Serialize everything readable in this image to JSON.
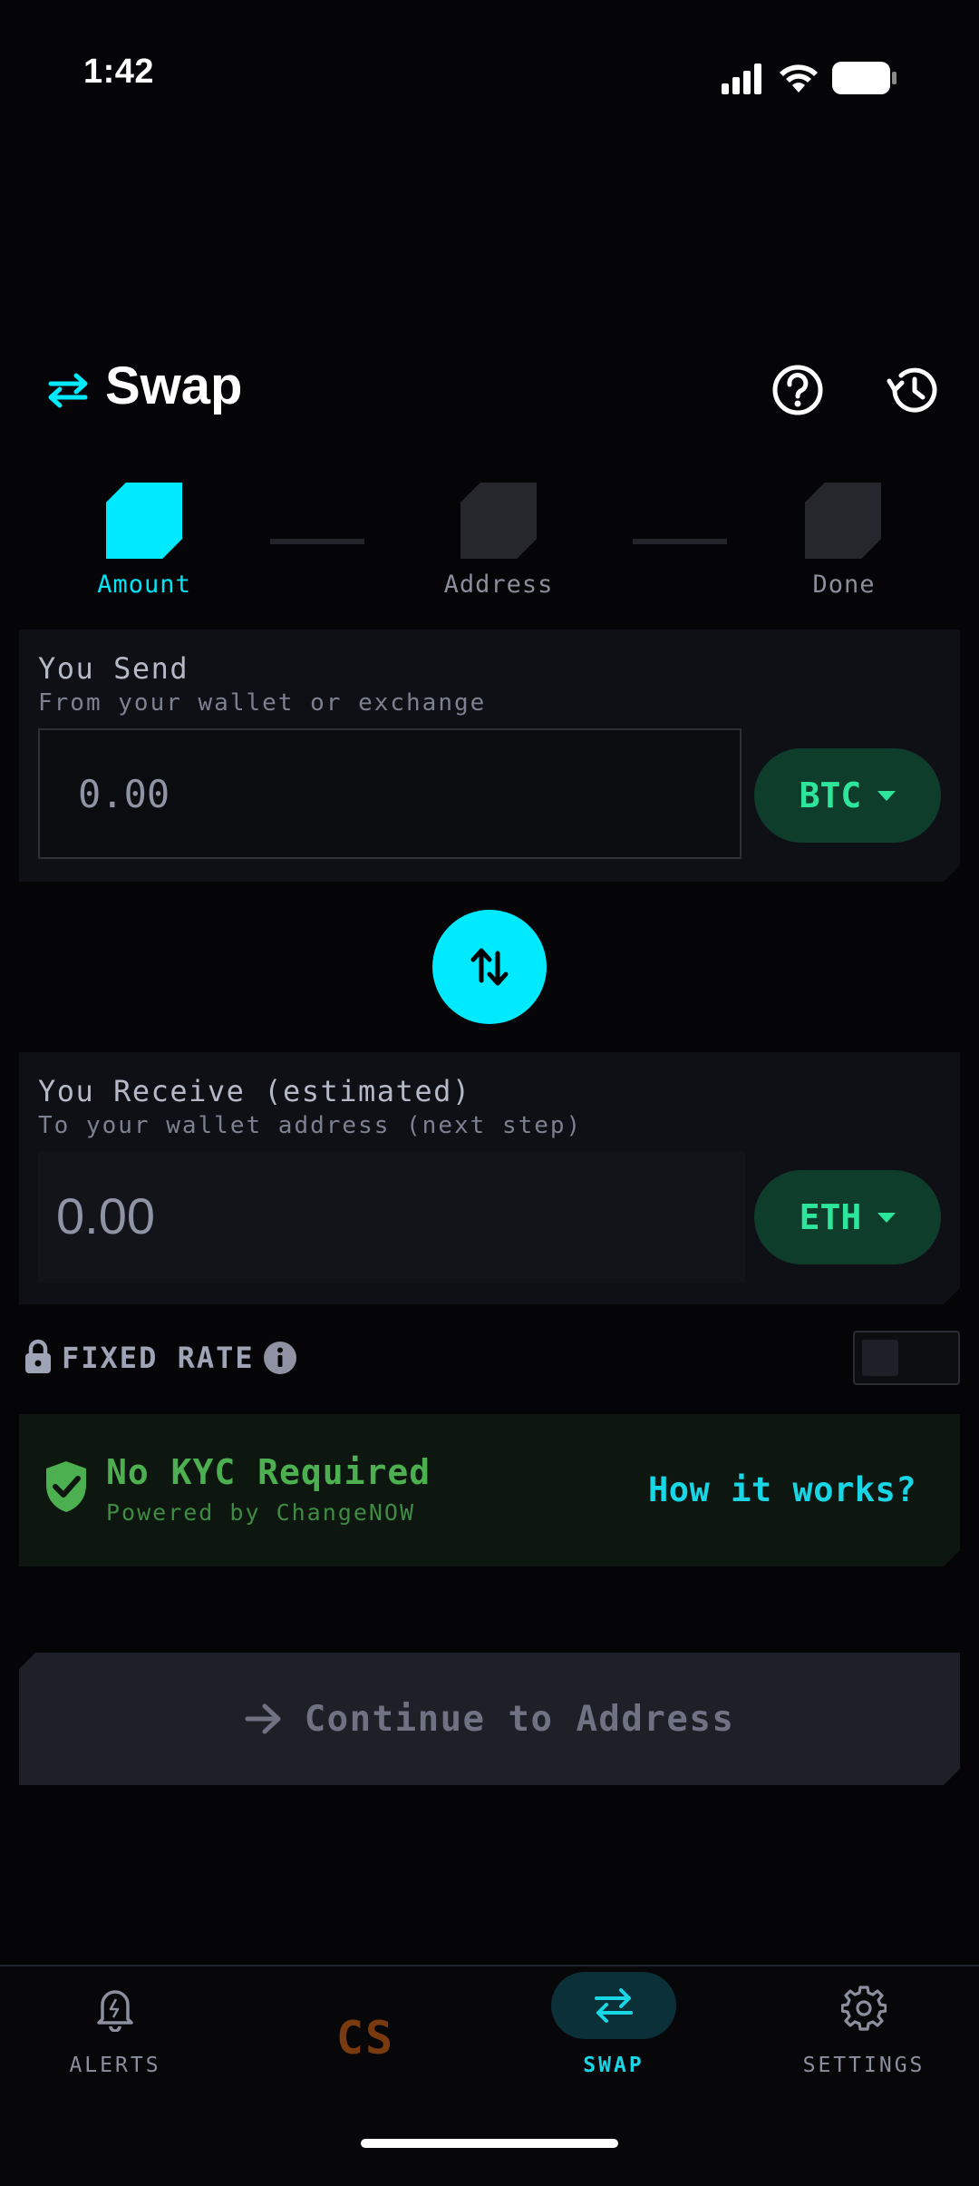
{
  "status_bar": {
    "time": "1:42"
  },
  "header": {
    "title": "Swap",
    "swap_icon": "swap-arrows-icon",
    "help_icon": "help-circle-icon",
    "history_icon": "history-icon",
    "accent_color": "#00eaff"
  },
  "stepper": {
    "steps": [
      {
        "label": "Amount",
        "active": true
      },
      {
        "label": "Address",
        "active": false
      },
      {
        "label": "Done",
        "active": false
      }
    ]
  },
  "send": {
    "title": "You Send",
    "subtitle": "From your wallet or exchange",
    "placeholder": "0.00",
    "currency": "BTC"
  },
  "receive": {
    "title": "You Receive (estimated)",
    "subtitle": "To your wallet address (next step)",
    "value": "0.00",
    "currency": "ETH"
  },
  "fixed_rate": {
    "label": "FIXED RATE",
    "enabled": false
  },
  "kyc_banner": {
    "title": "No KYC Required",
    "subtitle": "Powered by ChangeNOW",
    "link": "How it works?"
  },
  "continue_button": {
    "label": "Continue to Address"
  },
  "bottom_nav": {
    "items": [
      {
        "label": "ALERTS",
        "icon": "bell-icon",
        "active": false
      },
      {
        "label": "CS",
        "icon": "cs-logo",
        "active": false
      },
      {
        "label": "SWAP",
        "icon": "swap-arrows-icon",
        "active": true
      },
      {
        "label": "SETTINGS",
        "icon": "gear-icon",
        "active": false
      }
    ]
  }
}
